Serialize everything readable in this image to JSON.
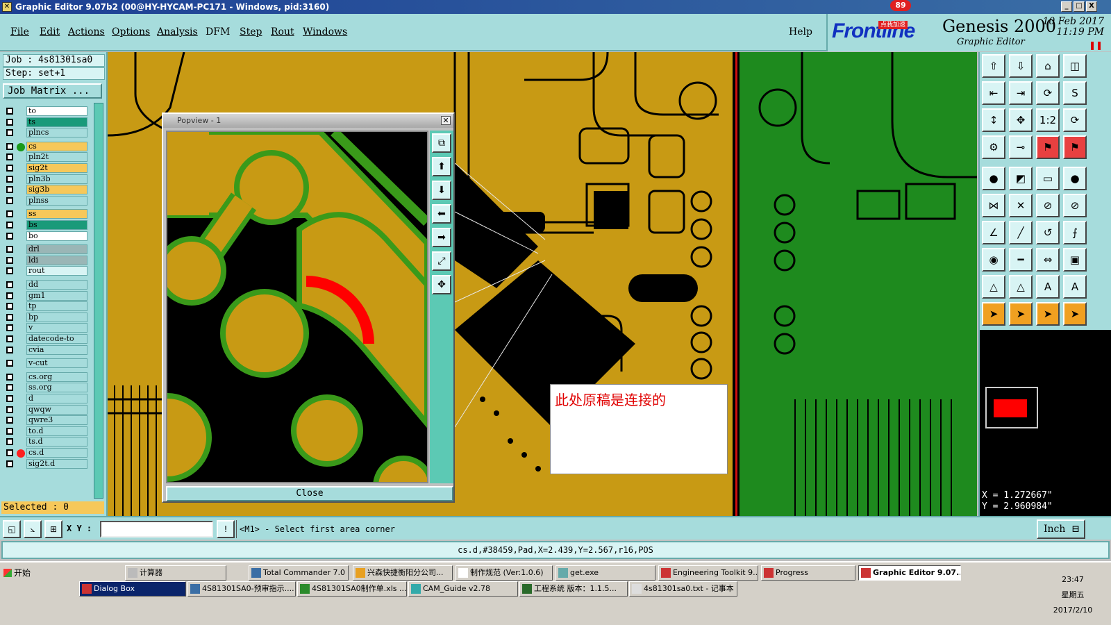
{
  "window": {
    "title": "Graphic Editor 9.07b2 (00@HY-HYCAM-PC171 - Windows, pid:3160)",
    "controls": [
      "_",
      "□",
      "X"
    ]
  },
  "menu": [
    "File",
    "Edit",
    "Actions",
    "Options",
    "Analysis",
    "DFM",
    "Step",
    "Rout",
    "Windows"
  ],
  "help": "Help",
  "brand": {
    "logo_main": "Frontline",
    "product": "Genesis 2000",
    "subtitle": "Graphic Editor",
    "date": "10 Feb 2017",
    "time": "11:19 PM",
    "badge": "89",
    "badge_text": "点我加速"
  },
  "job": {
    "job_label": "Job : 4s81301sa0",
    "step_label": "Step: set+1",
    "matrix_button": "Job Matrix ...",
    "selected": "Selected : 0"
  },
  "layers": [
    {
      "name": "to",
      "bg": "#ffffff"
    },
    {
      "name": "ts",
      "bg": "#1a9a7a"
    },
    {
      "name": "plncs",
      "bg": "#a6dcdc"
    },
    {
      "name": "cs",
      "bg": "#f6c85a",
      "dot": "#1a9a1a"
    },
    {
      "name": "pln2t",
      "bg": "#a6dcdc"
    },
    {
      "name": "sig2t",
      "bg": "#f6c85a"
    },
    {
      "name": "pln3b",
      "bg": "#a6dcdc"
    },
    {
      "name": "sig3b",
      "bg": "#f6c85a"
    },
    {
      "name": "plnss",
      "bg": "#a6dcdc"
    },
    {
      "name": "ss",
      "bg": "#f6c85a"
    },
    {
      "name": "bs",
      "bg": "#1a9a7a"
    },
    {
      "name": "bo",
      "bg": "#ffffff"
    },
    {
      "name": "drl",
      "bg": "#9ab6b6"
    },
    {
      "name": "ldi",
      "bg": "#9ab6b6"
    },
    {
      "name": "rout",
      "bg": "#d8f4f4"
    },
    {
      "name": "dd",
      "bg": "#a6dcdc"
    },
    {
      "name": "gm1",
      "bg": "#a6dcdc"
    },
    {
      "name": "tp",
      "bg": "#a6dcdc"
    },
    {
      "name": "bp",
      "bg": "#a6dcdc"
    },
    {
      "name": "v",
      "bg": "#a6dcdc"
    },
    {
      "name": "datecode-to",
      "bg": "#a6dcdc"
    },
    {
      "name": "cvia",
      "bg": "#a6dcdc"
    },
    {
      "name": "v-cut",
      "bg": "#a6dcdc"
    },
    {
      "name": "cs.org",
      "bg": "#a6dcdc"
    },
    {
      "name": "ss.org",
      "bg": "#a6dcdc"
    },
    {
      "name": "d",
      "bg": "#a6dcdc"
    },
    {
      "name": "qwqw",
      "bg": "#a6dcdc"
    },
    {
      "name": "qwre3",
      "bg": "#a6dcdc"
    },
    {
      "name": "to.d",
      "bg": "#a6dcdc"
    },
    {
      "name": "ts.d",
      "bg": "#a6dcdc"
    },
    {
      "name": "cs.d",
      "bg": "#a6dcdc",
      "dot": "#ff2020"
    },
    {
      "name": "sig2t.d",
      "bg": "#a6dcdc"
    }
  ],
  "popview": {
    "title": "Popview - 1",
    "close_label": "Close"
  },
  "annotation": "此处原稿是连接的",
  "coords": {
    "x": "X = 1.272667\"",
    "y": "Y = 2.960984\""
  },
  "cmd": {
    "xy_label": "X Y :",
    "xy_value": "",
    "prompt": "<M1> - Select first area corner",
    "unit": "Inch"
  },
  "status": "cs.d,#38459,Pad,X=2.439,Y=2.567,r16,POS",
  "taskbar": {
    "start": "开始",
    "row1": [
      "计算器",
      "Total Commander 7.0 ...",
      "兴森快捷衡阳分公司...",
      "制作规范 (Ver:1.0.6)",
      "get.exe",
      "Engineering Toolkit 9....",
      "Progress",
      "Graphic Editor 9.07..."
    ],
    "row2": [
      "Dialog Box",
      "4S81301SA0-预审指示....",
      "4S81301SA0制作单.xls ...",
      "CAM_Guide v2.78",
      "工程系统  版本：1.1.5...",
      "4s81301sa0.txt - 记事本"
    ],
    "clock": "23:47",
    "weekday": "星期五",
    "date": "2017/2/10"
  },
  "colors": {
    "copper": "#c89a14",
    "board_green": "#1e8a1e",
    "trace_black": "#000000",
    "highlight_red": "#ff2020"
  }
}
